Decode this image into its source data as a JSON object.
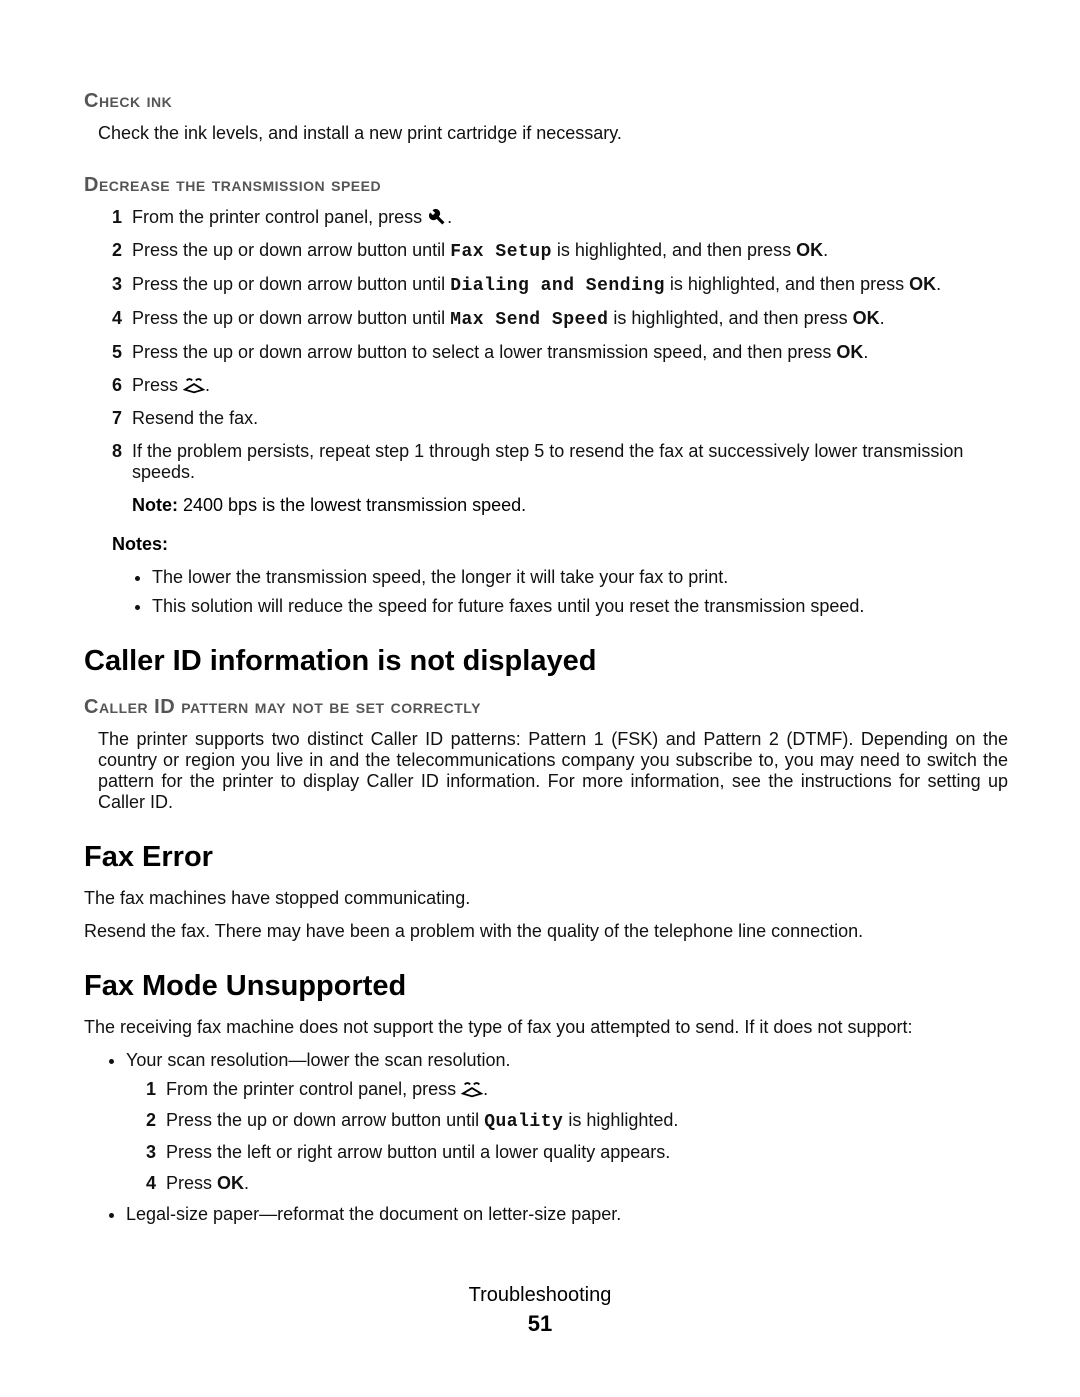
{
  "sections": {
    "check_ink": {
      "heading": "Check ink",
      "body": "Check the ink levels, and install a new print cartridge if necessary."
    },
    "decrease_speed": {
      "heading": "Decrease the transmission speed",
      "step1_pre": "From the printer control panel, press ",
      "step1_post": ".",
      "step2_pre": "Press the up or down arrow button until ",
      "step2_term": "Fax Setup",
      "step2_mid": " is highlighted, and then press ",
      "step2_ok": "OK",
      "step2_post": ".",
      "step3_pre": "Press the up or down arrow button until ",
      "step3_term": "Dialing and Sending",
      "step3_mid": " is highlighted, and then press ",
      "step3_ok": "OK",
      "step3_post": ".",
      "step4_pre": "Press the up or down arrow button until ",
      "step4_term": "Max Send Speed",
      "step4_mid": " is highlighted, and then press ",
      "step4_ok": "OK",
      "step4_post": ".",
      "step5_pre": "Press the up or down arrow button to select a lower transmission speed, and then press ",
      "step5_ok": "OK",
      "step5_post": ".",
      "step6_pre": "Press ",
      "step6_post": ".",
      "step7": "Resend the fax.",
      "step8": "If the problem persists, repeat step 1 through step 5 to resend the fax at successively lower transmission speeds.",
      "note_label": "Note:",
      "note_text": " 2400 bps is the lowest transmission speed.",
      "notes_heading": "Notes:",
      "bullet1": "The lower the transmission speed, the longer it will take your fax to print.",
      "bullet2": "This solution will reduce the speed for future faxes until you reset the transmission speed."
    },
    "caller_id": {
      "heading": "Caller ID information is not displayed",
      "subheading": "Caller ID pattern may not be set correctly",
      "body": "The printer supports two distinct Caller ID patterns: Pattern 1 (FSK) and Pattern 2 (DTMF). Depending on the country or region you live in and the telecommunications company you subscribe to, you may need to switch the pattern for the printer to display Caller ID information. For more information, see the instructions for setting up Caller ID."
    },
    "fax_error": {
      "heading": "Fax Error",
      "line1": "The fax machines have stopped communicating.",
      "line2": "Resend the fax. There may have been a problem with the quality of the telephone line connection."
    },
    "fax_mode": {
      "heading": "Fax Mode Unsupported",
      "intro": "The receiving fax machine does not support the type of fax you attempted to send. If it does not support:",
      "bullet_scan": "Your scan resolution—lower the scan resolution.",
      "s1_pre": "From the printer control panel, press ",
      "s1_post": ".",
      "s2_pre": "Press the up or down arrow button until ",
      "s2_term": "Quality",
      "s2_post": " is highlighted.",
      "s3": "Press the left or right arrow button until a lower quality appears.",
      "s4_pre": "Press ",
      "s4_ok": "OK",
      "s4_post": ".",
      "bullet_legal": "Legal-size paper—reformat the document on letter-size paper."
    }
  },
  "footer": {
    "chapter": "Troubleshooting",
    "page": "51"
  }
}
